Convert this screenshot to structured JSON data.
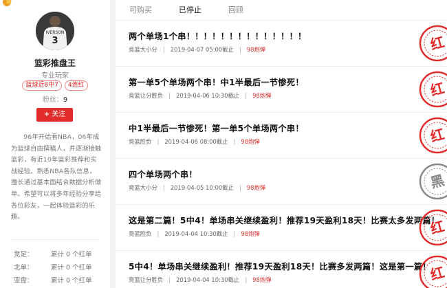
{
  "tabs": [
    "可购买",
    "已停止",
    "回顾"
  ],
  "active_tab": 1,
  "profile": {
    "jersey_text": "IVERSON",
    "jersey_number": "3",
    "name": "篮彩推盘王",
    "role": "专业玩家",
    "badges": [
      "篮球近8中7",
      "4连红"
    ],
    "fans_label": "粉丝：",
    "fans_count": "9",
    "follow_label": "关注",
    "bio": "96年开始看NBA，06年成为篮球自由撰稿人，并逐渐接触篮彩，有近10年篮彩推荐和实战经验。熟悉NBA各队信息，擅长通过基本面结合数据分析做单。希望可以将多年经验分享给各位彩友，一起体验篮彩的乐趣。",
    "stats": [
      {
        "label": "竞足：",
        "value": "累计 0 个红单"
      },
      {
        "label": "北单：",
        "value": "累计 0 个红单"
      },
      {
        "label": "亚盘：",
        "value": "累计 0 个红单"
      }
    ]
  },
  "articles": [
    {
      "title": "两个单场1个串！！！！！！！！！！！！！！",
      "category": "竞篮大小分",
      "time": "2019-04-07 05:00截止",
      "price": "98炮弹",
      "result": "红"
    },
    {
      "title": "第一单5个单场两个串！中1半最后一节惨死！",
      "category": "竞篮让分胜负",
      "time": "2019-04-06 10:30截止",
      "price": "98炮弹",
      "result": "红"
    },
    {
      "title": "中1半最后一节惨死！第一单5个单场两个串！",
      "category": "竞篮胜负",
      "time": "2019-04-06 08:00截止",
      "price": "98炮弹",
      "result": "红"
    },
    {
      "title": "四个单场两个串！",
      "category": "竞篮大小分",
      "time": "2019-04-05 10:00截止",
      "price": "98炮弹",
      "result": "黑"
    },
    {
      "title": "这是第二篇！5中4！单场串关继续盈利！推荐19天盈利18天！比赛太多发两篇！",
      "category": "竞篮胜负",
      "time": "2019-04-04 10:30截止",
      "price": "98炮弹",
      "result": "红"
    },
    {
      "title": "5中4！单场串关继续盈利！推荐19天盈利18天！比赛多发两篇！这是第一篇！",
      "category": "竞篮让分胜负",
      "time": "2019-04-04 10:30截止",
      "price": "98炮弹",
      "result": "红"
    }
  ],
  "colors": {
    "red": "#e22b2b",
    "gray_stamp": "#888888"
  }
}
